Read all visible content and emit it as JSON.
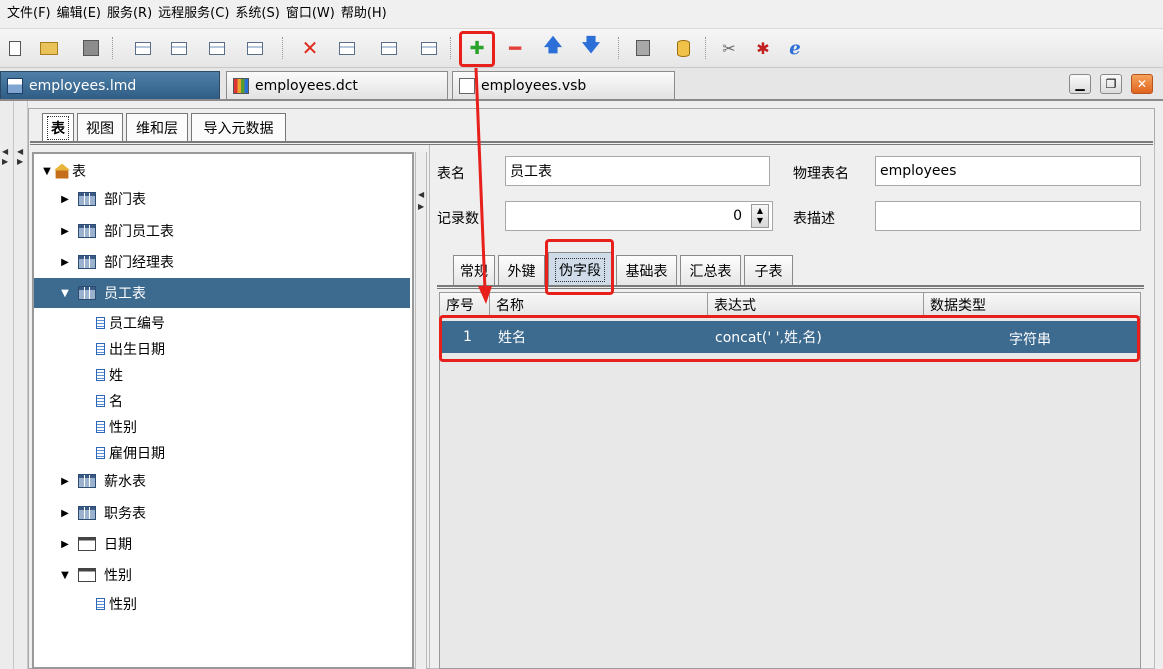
{
  "menu": [
    "文件(F)",
    "编辑(E)",
    "服务(R)",
    "远程服务(C)",
    "系统(S)",
    "窗口(W)",
    "帮助(H)"
  ],
  "toolbar": {
    "icons": [
      "new-icon",
      "open-folder-icon",
      "save-icon",
      "add-table-icon",
      "add-sql-table-icon",
      "table-icon",
      "table-edit-icon",
      "delete-icon",
      "copy-table-icon",
      "import-icon",
      "export-icon",
      "add-icon",
      "remove-icon",
      "move-up-icon",
      "move-down-icon",
      "paste-icon",
      "database-icon",
      "tools-icon",
      "debug-icon",
      "web-icon"
    ]
  },
  "doc_tabs": [
    {
      "label": "employees.lmd",
      "icon": "lmd-file-icon",
      "active": true
    },
    {
      "label": "employees.dct",
      "icon": "dct-file-icon",
      "active": false
    },
    {
      "label": "employees.vsb",
      "icon": "vsb-file-icon",
      "active": false
    }
  ],
  "sub_tabs": [
    "表",
    "视图",
    "维和层",
    "导入元数据"
  ],
  "tree": {
    "root": "表",
    "nodes": [
      {
        "label": "部门表",
        "kind": "table"
      },
      {
        "label": "部门员工表",
        "kind": "table"
      },
      {
        "label": "部门经理表",
        "kind": "table"
      },
      {
        "label": "员工表",
        "kind": "table",
        "selected": true,
        "expanded": true
      },
      {
        "label": "员工编号",
        "kind": "field"
      },
      {
        "label": "出生日期",
        "kind": "field"
      },
      {
        "label": "姓",
        "kind": "field"
      },
      {
        "label": "名",
        "kind": "field"
      },
      {
        "label": "性别",
        "kind": "field"
      },
      {
        "label": "雇佣日期",
        "kind": "field"
      },
      {
        "label": "薪水表",
        "kind": "table"
      },
      {
        "label": "职务表",
        "kind": "table"
      },
      {
        "label": "日期",
        "kind": "dimension"
      },
      {
        "label": "性别",
        "kind": "dimension",
        "expanded": true
      },
      {
        "label": "性别",
        "kind": "field"
      }
    ]
  },
  "form": {
    "table_name_label": "表名",
    "table_name_value": "员工表",
    "physical_name_label": "物理表名",
    "physical_name_value": "employees",
    "record_count_label": "记录数",
    "record_count_value": "0",
    "description_label": "表描述",
    "description_value": ""
  },
  "field_tabs": [
    "常规",
    "外键",
    "伪字段",
    "基础表",
    "汇总表",
    "子表"
  ],
  "grid": {
    "columns": [
      "序号",
      "名称",
      "表达式",
      "数据类型"
    ],
    "rows": [
      {
        "no": "1",
        "name": "姓名",
        "expr": "concat(' ',姓,名)",
        "type": "字符串"
      }
    ]
  },
  "colors": {
    "selection": "#3d6a8f",
    "annotation": "#e8201c"
  }
}
